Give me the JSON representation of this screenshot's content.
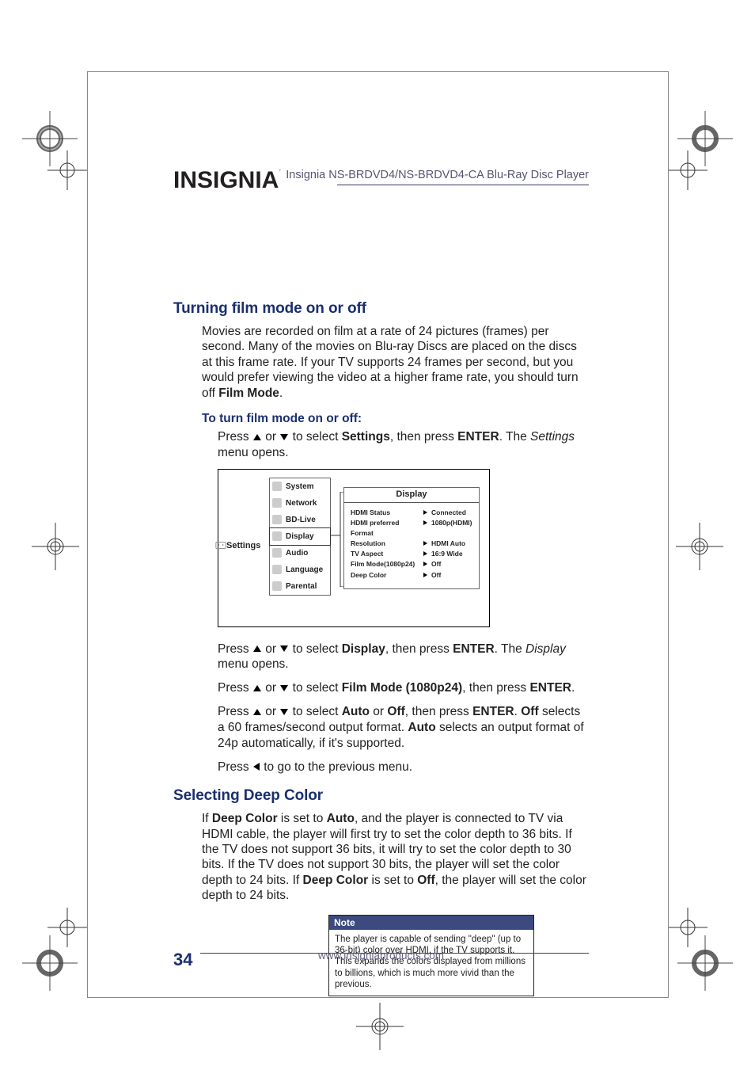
{
  "brand": "INSIGNIA",
  "header_product": "Insignia NS-BRDVD4/NS-BRDVD4-CA Blu-Ray Disc Player",
  "section1": {
    "title": "Turning film mode on or off",
    "intro_parts": [
      "Movies are recorded on film at a rate of 24 pictures (frames) per second. Many of the movies on Blu-ray Discs are placed on the discs at this frame rate. If your TV supports 24 frames per second, but you would prefer viewing the video at a higher frame rate, you should turn off ",
      "Film Mode",
      "."
    ],
    "subhead": "To turn film mode on or off:",
    "step1": {
      "pre": "Press ",
      "mid": " or ",
      "post1": " to select ",
      "b1": "Settings",
      "post2": ", then press ",
      "b2": "ENTER",
      "post3": ". The ",
      "i1": "Settings",
      "post4": " menu opens."
    },
    "step2": {
      "pre": "Press ",
      "mid": " or ",
      "post1": " to select ",
      "b1": "Display",
      "post2": ", then press ",
      "b2": "ENTER",
      "post3": ". The ",
      "i1": "Display",
      "post4": " menu opens."
    },
    "step3": {
      "pre": "Press ",
      "mid": " or ",
      "post1": " to select ",
      "b1": "Film Mode (1080p24)",
      "post2": ", then press ",
      "b2": "ENTER",
      "post3": "."
    },
    "step4": {
      "pre": "Press ",
      "mid": " or ",
      "post1": " to select ",
      "b1": "Auto",
      "post2": " or ",
      "b2": "Off",
      "post3": ", then press ",
      "b3": "ENTER",
      "post4": ". ",
      "b4": "Off",
      "post5": " selects a 60 frames/second output format. ",
      "b5": "Auto",
      "post6": " selects an output format of 24p automatically, if it's supported."
    },
    "step5": {
      "pre": "Press ",
      "post": " to go to the previous menu."
    }
  },
  "figure": {
    "settings_label": "Settings",
    "menu": [
      "System",
      "Network",
      "BD-Live",
      "Display",
      "Audio",
      "Language",
      "Parental"
    ],
    "panel_title": "Display",
    "rows": [
      {
        "label": "HDMI Status",
        "value": "Connected"
      },
      {
        "label": "HDMI preferred Format",
        "value": "1080p(HDMI)"
      },
      {
        "label": "Resolution",
        "value": "HDMI Auto"
      },
      {
        "label": "TV Aspect",
        "value": "16:9 Wide"
      },
      {
        "label": "Film Mode(1080p24)",
        "value": "Off"
      },
      {
        "label": "Deep Color",
        "value": "Off"
      }
    ]
  },
  "section2": {
    "title": "Selecting Deep Color",
    "body_parts": [
      "If ",
      "Deep Color",
      " is set to ",
      "Auto",
      ", and the player is connected to TV via HDMI cable, the player will first try to set the color depth to 36 bits. If the TV does not support 36 bits, it will try to set the color depth to 30 bits. If the TV does not support 30 bits, the player will set the color depth to 24 bits. If ",
      "Deep Color",
      " is set to ",
      "Off",
      ", the player will set the color depth to 24 bits."
    ]
  },
  "note": {
    "title": "Note",
    "body": "The player is capable of sending \"deep\" (up to 36-bit) color over HDMI, if the TV supports it. This expands the colors displayed from millions to billions, which is much more vivid than the previous."
  },
  "page_number": "34",
  "footer_url": "www.insigniaproducts.com"
}
